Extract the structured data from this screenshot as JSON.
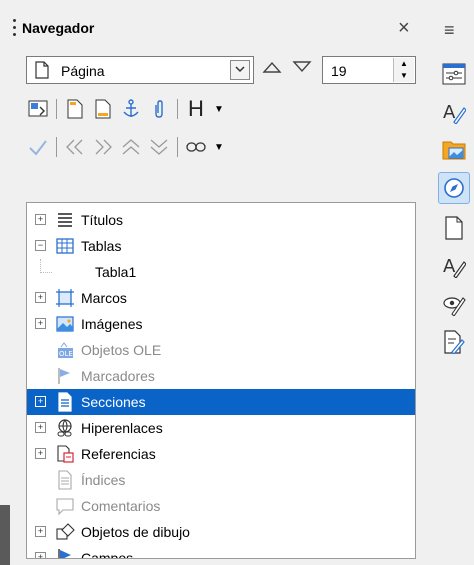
{
  "panel": {
    "title": "Navegador",
    "close_symbol": "×",
    "menu_symbol": "≡"
  },
  "navigate_by": {
    "selected": "Página",
    "dropdown_icon": "chevron-down-icon"
  },
  "page_spin": {
    "value": "19"
  },
  "toolbar1": {
    "items": [
      "toggle-icon",
      "header-icon",
      "footer-icon",
      "anchor-icon",
      "attachment-icon",
      "heading-icon"
    ]
  },
  "toolbar2": {
    "items": [
      "check-icon",
      "promote-chapter-icon",
      "demote-chapter-icon",
      "promote-level-icon",
      "demote-level-icon",
      "link-icon"
    ]
  },
  "tree": {
    "items": [
      {
        "label": "Títulos",
        "icon": "headings-icon",
        "expander": "+",
        "enabled": true
      },
      {
        "label": "Tablas",
        "icon": "table-icon",
        "expander": "−",
        "enabled": true
      },
      {
        "label": "Tabla1",
        "icon": "",
        "expander": "",
        "enabled": true,
        "child": true
      },
      {
        "label": "Marcos",
        "icon": "frame-icon",
        "expander": "+",
        "enabled": true
      },
      {
        "label": "Imágenes",
        "icon": "image-icon",
        "expander": "+",
        "enabled": true
      },
      {
        "label": "Objetos OLE",
        "icon": "ole-icon",
        "expander": "",
        "enabled": false
      },
      {
        "label": "Marcadores",
        "icon": "bookmark-icon",
        "expander": "",
        "enabled": false
      },
      {
        "label": "Secciones",
        "icon": "section-icon",
        "expander": "+",
        "enabled": true,
        "selected": true
      },
      {
        "label": "Hiperenlaces",
        "icon": "hyperlink-icon",
        "expander": "+",
        "enabled": true
      },
      {
        "label": "Referencias",
        "icon": "reference-icon",
        "expander": "+",
        "enabled": true
      },
      {
        "label": "Índices",
        "icon": "index-icon",
        "expander": "",
        "enabled": false
      },
      {
        "label": "Comentarios",
        "icon": "comment-icon",
        "expander": "",
        "enabled": false
      },
      {
        "label": "Objetos de dibujo",
        "icon": "drawing-object-icon",
        "expander": "+",
        "enabled": true
      },
      {
        "label": "Campos",
        "icon": "field-icon",
        "expander": "+",
        "enabled": true
      }
    ]
  },
  "sidebar": {
    "items": [
      "properties-icon",
      "styles-icon",
      "gallery-icon",
      "navigator-icon",
      "page-icon",
      "style-inspector-icon",
      "manage-changes-icon",
      "design-icon"
    ],
    "active": "navigator-icon"
  },
  "colors": {
    "selection": "#0a64c8",
    "active_sidebar": "#cfe3f7"
  }
}
